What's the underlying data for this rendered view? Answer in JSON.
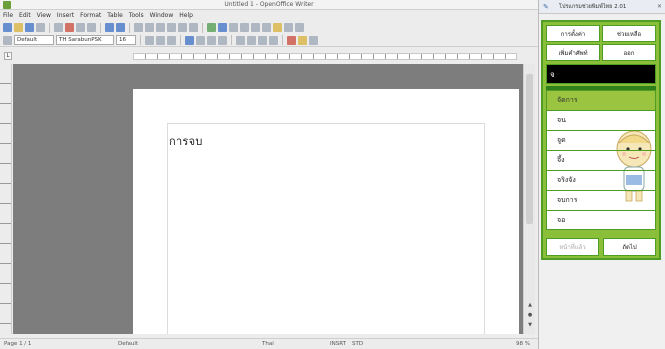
{
  "window": {
    "title": "Untitled 1 - OpenOffice Writer"
  },
  "menu": [
    "File",
    "Edit",
    "View",
    "Insert",
    "Format",
    "Table",
    "Tools",
    "Window",
    "Help"
  ],
  "toolbar": {
    "style_value": "Default",
    "font_value": "TH SarabunPSK",
    "size_value": "16"
  },
  "document": {
    "text": "การจบ"
  },
  "status": {
    "page": "Page 1 / 1",
    "style": "Default",
    "language": "Thai",
    "mode": "INSRT",
    "selection": "STD",
    "zoom": "98 %"
  },
  "panel": {
    "title": "โปรแกรมช่วยพิมพ์ไทย 2.01",
    "buttons": [
      "การตั้งค่า",
      "ช่วยเหลือ",
      "เพิ่มคำศัพท์",
      "ออก"
    ],
    "input_value": "จ",
    "words": [
      "จัดการ",
      "จน",
      "จูด",
      "จึ้ง",
      "จริงจัง",
      "จบการ",
      "จอ"
    ],
    "selected_index": 0,
    "prev_label": "หน้าที่แล้ว",
    "next_label": "ถัดไป"
  }
}
